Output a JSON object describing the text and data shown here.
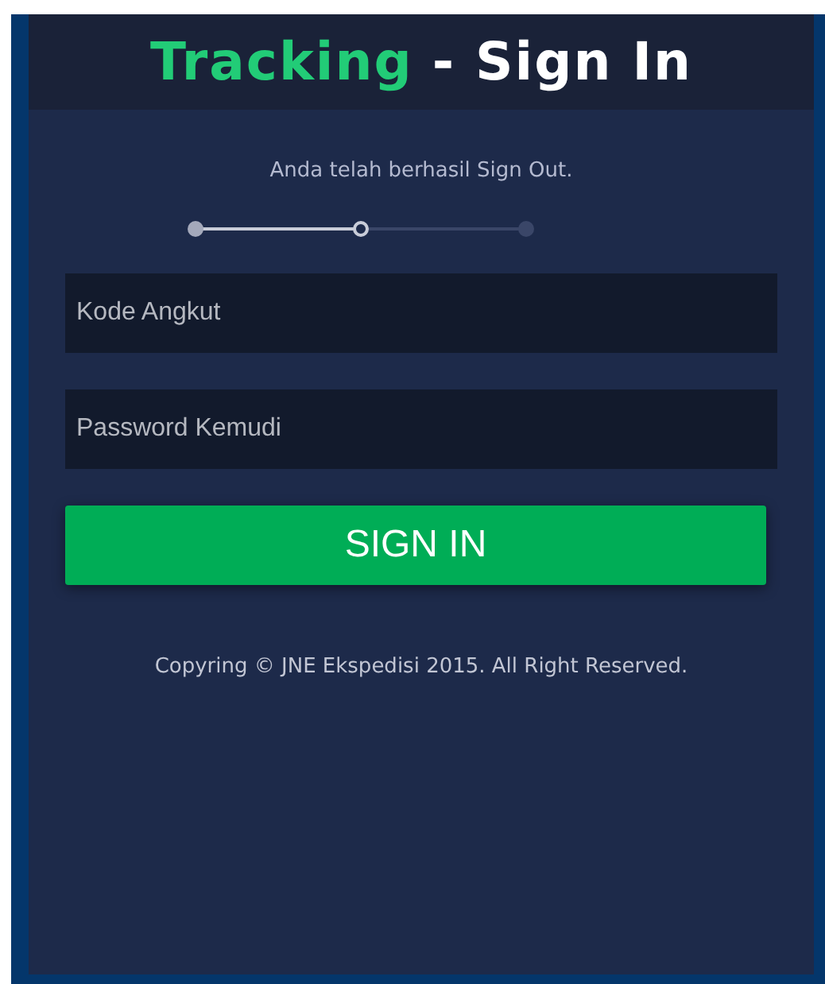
{
  "title": {
    "highlight": "Tracking",
    "rest": "- Sign In"
  },
  "message": "Anda telah berhasil Sign Out.",
  "progress_steps": [
    {
      "kind": "done"
    },
    {
      "kind": "current"
    },
    {
      "kind": "pending"
    }
  ],
  "fields": [
    {
      "placeholder": "Kode Angkut"
    },
    {
      "placeholder": "Password Kemudi"
    }
  ],
  "button": "SIGN IN",
  "footer": "Copyring © JNE Ekspedisi 2015. All Right Reserved."
}
